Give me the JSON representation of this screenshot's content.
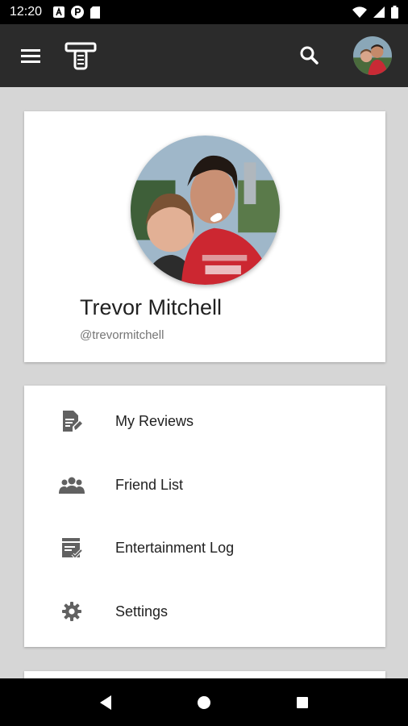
{
  "status_bar": {
    "time": "12:20"
  },
  "app_bar": {
    "logo": "tape-logo",
    "search_icon": "search-icon",
    "avatar": "user-avatar"
  },
  "profile": {
    "name": "Trevor Mitchell",
    "handle": "@trevormitchell"
  },
  "menu": {
    "items": [
      {
        "label": "My Reviews",
        "icon": "review-icon"
      },
      {
        "label": "Friend List",
        "icon": "friends-icon"
      },
      {
        "label": "Entertainment Log",
        "icon": "log-icon"
      },
      {
        "label": "Settings",
        "icon": "gear-icon"
      }
    ]
  },
  "colors": {
    "app_bar": "#2b2b2b",
    "background": "#d6d6d6",
    "card": "#ffffff",
    "icon": "#616161"
  }
}
